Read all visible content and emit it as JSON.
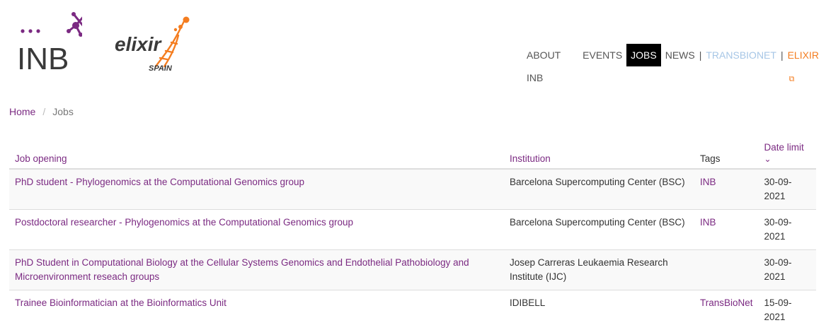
{
  "logos": {
    "inb_text": "INB",
    "elixir_text": "elixir",
    "elixir_sub": "SPAIN"
  },
  "nav": {
    "items": [
      {
        "label": "ABOUT INB"
      },
      {
        "label": "EVENTS"
      },
      {
        "label": "JOBS",
        "active": true
      },
      {
        "label": "NEWS"
      },
      {
        "label": "TRANSBIONET"
      },
      {
        "label": "ELIXIR",
        "external": true
      }
    ]
  },
  "breadcrumb": {
    "home": "Home",
    "current": "Jobs"
  },
  "table": {
    "headers": {
      "title": "Job opening",
      "institution": "Institution",
      "tags": "Tags",
      "date": "Date limit"
    },
    "rows": [
      {
        "title": "PhD student - Phylogenomics at the Computational Genomics group",
        "institution": "Barcelona Supercomputing Center (BSC)",
        "tag": "INB",
        "date": "30-09-2021"
      },
      {
        "title": "Postdoctoral researcher - Phylogenomics at the Computational Genomics group",
        "institution": "Barcelona Supercomputing Center (BSC)",
        "tag": "INB",
        "date": "30-09-2021"
      },
      {
        "title": "PhD Student in Computational Biology at the Cellular Systems Genomics and Endothelial Pathobiology and Microenvironment reseach groups",
        "institution": "Josep Carreras Leukaemia Research Institute (IJC)",
        "tag": "",
        "date": "30-09-2021"
      },
      {
        "title": "Trainee Bioinformatician at the Bioinformatics Unit",
        "institution": "IDIBELL",
        "tag": "TransBioNet",
        "date": "15-09-2021"
      }
    ]
  },
  "colors": {
    "accent": "#7b2a82",
    "elixir_orange": "#f47d20",
    "transbionet_blue": "#a6c6e6"
  }
}
